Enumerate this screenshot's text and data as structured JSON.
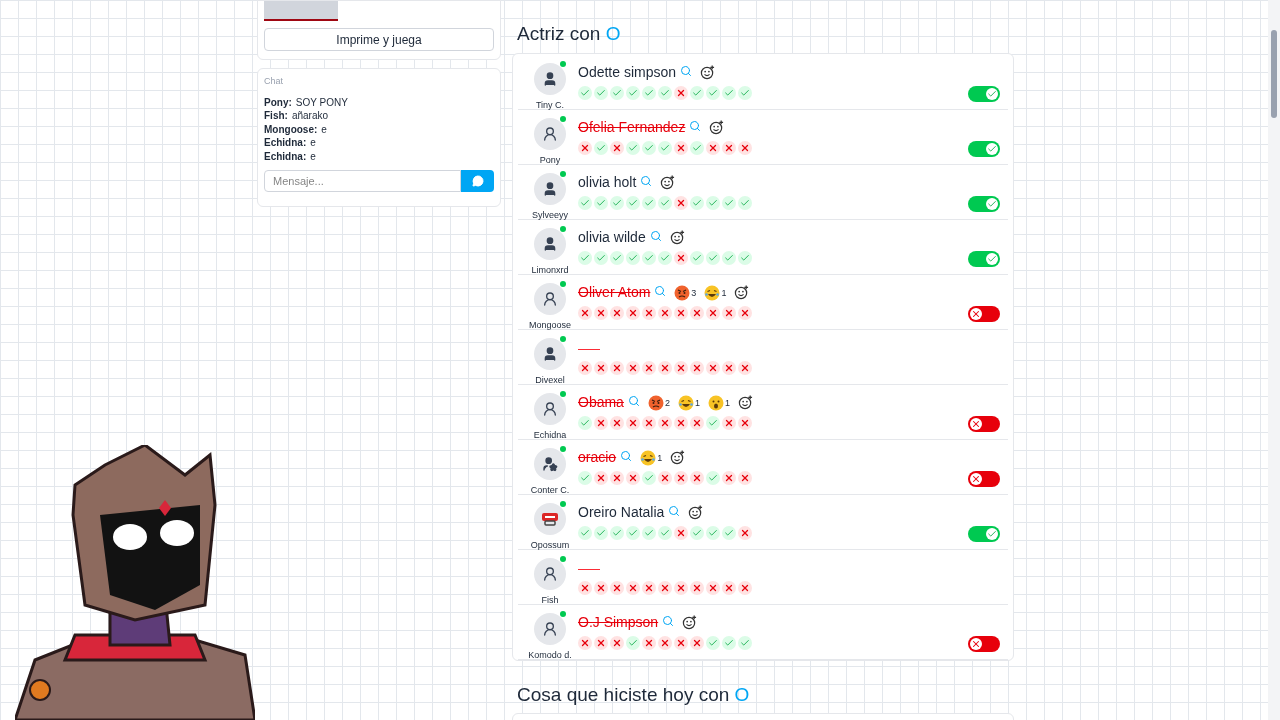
{
  "sidebar": {
    "print_button": "Imprime y juega",
    "chat": {
      "title": "Chat",
      "messages": [
        {
          "user": "Pony:",
          "text": "SOY PONY"
        },
        {
          "user": "Fish:",
          "text": "añarako"
        },
        {
          "user": "Mongoose:",
          "text": "e"
        },
        {
          "user": "Echidna:",
          "text": "e"
        },
        {
          "user": "Echidna:",
          "text": "e"
        }
      ],
      "placeholder": "Mensaje..."
    }
  },
  "sections": [
    {
      "title": "Actriz con",
      "letter": "O",
      "rows": [
        {
          "kind": "person",
          "user": "Tiny C.",
          "name": "Odette simpson",
          "struck": false,
          "votes": [
            true,
            true,
            true,
            true,
            true,
            true,
            false,
            true,
            true,
            true,
            true
          ],
          "toggle": true
        },
        {
          "kind": "outline",
          "user": "Pony",
          "name": "Ofelia Fernandez",
          "struck": true,
          "votes": [
            false,
            true,
            false,
            true,
            true,
            true,
            false,
            true,
            false,
            false,
            false
          ],
          "toggle": true
        },
        {
          "kind": "person",
          "user": "Sylveeyy",
          "name": "olivia holt",
          "struck": false,
          "votes": [
            true,
            true,
            true,
            true,
            true,
            true,
            false,
            true,
            true,
            true,
            true
          ],
          "toggle": true
        },
        {
          "kind": "person",
          "user": "Limonxrd",
          "name": "olivia wilde",
          "struck": false,
          "votes": [
            true,
            true,
            true,
            true,
            true,
            true,
            false,
            true,
            true,
            true,
            true
          ],
          "toggle": true
        },
        {
          "kind": "outline",
          "user": "Mongoose",
          "name": "Oliver Atom",
          "struck": true,
          "reactions": [
            {
              "kind": "angry",
              "count": "3"
            },
            {
              "kind": "laugh",
              "count": "1"
            }
          ],
          "votes": [
            false,
            false,
            false,
            false,
            false,
            false,
            false,
            false,
            false,
            false,
            false
          ],
          "toggle": false
        },
        {
          "kind": "person",
          "user": "Divexel",
          "struck": true,
          "votes": [
            false,
            false,
            false,
            false,
            false,
            false,
            false,
            false,
            false,
            false,
            false
          ]
        },
        {
          "kind": "outline",
          "user": "Echidna",
          "name": "Obama",
          "struck": true,
          "reactions": [
            {
              "kind": "angry",
              "count": "2"
            },
            {
              "kind": "laugh",
              "count": "1"
            },
            {
              "kind": "surprised",
              "count": "1"
            }
          ],
          "votes": [
            true,
            false,
            false,
            false,
            false,
            false,
            false,
            false,
            true,
            false,
            false
          ],
          "toggle": false
        },
        {
          "kind": "star",
          "user": "Conter C.",
          "name": "oracio",
          "struck": true,
          "reactions": [
            {
              "kind": "laugh",
              "count": "1"
            }
          ],
          "votes": [
            true,
            false,
            false,
            false,
            true,
            false,
            false,
            false,
            true,
            false,
            false
          ],
          "toggle": false
        },
        {
          "kind": "stop",
          "user": "Opossum",
          "name": "Oreiro Natalia",
          "struck": false,
          "votes": [
            true,
            true,
            true,
            true,
            true,
            true,
            false,
            true,
            true,
            true,
            false
          ],
          "toggle": true
        },
        {
          "kind": "outline",
          "user": "Fish",
          "struck": true,
          "votes": [
            false,
            false,
            false,
            false,
            false,
            false,
            false,
            false,
            false,
            false,
            false
          ]
        },
        {
          "kind": "outline",
          "user": "Komodo d.",
          "name": "O.J Simpson",
          "struck": true,
          "votes": [
            false,
            false,
            false,
            true,
            false,
            false,
            false,
            false,
            true,
            true,
            true
          ],
          "toggle": false
        }
      ]
    },
    {
      "title": "Cosa que hiciste hoy con",
      "letter": "O"
    }
  ]
}
